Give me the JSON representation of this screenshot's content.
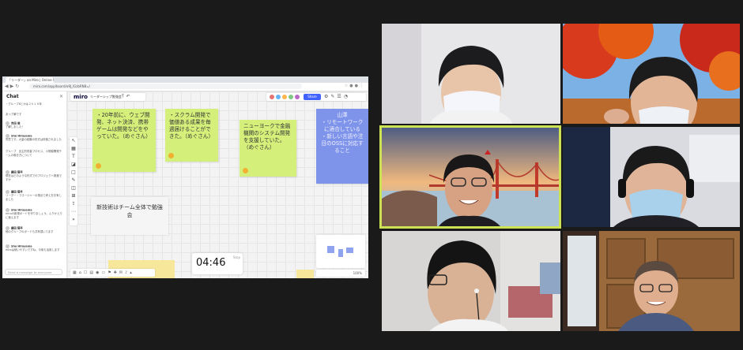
{
  "browser": {
    "tab_title": "「リーダー」on Miro | Online Whiteboard",
    "url": "miro.com/app/board/o9J_lGzbRN8=/"
  },
  "chat": {
    "title": "Chat",
    "close_icon": "close-icon",
    "messages": [
      {
        "name": "",
        "text": "・グループ6とかは２０１９年"
      },
      {
        "name": "",
        "text": "あっ了解です"
      },
      {
        "name": "吉田 雅",
        "text": "了解しました！"
      },
      {
        "name": "Sho Hirayama",
        "text": "同意です。大量の経験の形式は評価されました"
      },
      {
        "name": "",
        "text": "グループ　自主的改善プロセス、小規模開発チームの働き方について"
      },
      {
        "name": "藤田 陽平",
        "text": "現在はどのような形式でのプロジェクト推進ですか"
      },
      {
        "name": "藤田 陽平",
        "text": "リーダー・マネージャーの視点で考えを共有しました"
      },
      {
        "name": "Sho Hirayama",
        "text": "miroの新規ボードを作りましょう。ふりかえりに使えます"
      },
      {
        "name": "藤田 陽平",
        "text": "他のグループのボードも共有頂いてます"
      },
      {
        "name": "Sho Hirayama",
        "text": "miroは使いやすいですね。今後も活用します"
      }
    ],
    "input_placeholder": "Send a message to everyone"
  },
  "miro": {
    "logo": "miro",
    "board_name": "リーダーシップ勉強会",
    "share_label": "Share",
    "stickies": [
      {
        "text": "・20年前に、ウェブ開発、ネット決済、携帯ゲームは開発などをやっていた。（めぐさん）",
        "color": "#d4f07b"
      },
      {
        "text": "・スクラム開発で価値ある成果を毎週届けることができた。（めぐさん）",
        "color": "#d4f07b"
      },
      {
        "text": "ニューヨークで金融機関のシステム開発を支援していた。（めぐさん）",
        "color": "#d4f07b"
      },
      {
        "text": "山澤\n・リモートワークに適合している\n・新しい言語や注目のOSSに対応すること",
        "color": "#7e93ea"
      }
    ],
    "card_text": "新技術はチーム全体で勉強会",
    "timer": "04:46",
    "timer_label": "Stop",
    "zoom": "100%"
  },
  "participants": [
    {
      "tile": "top-left",
      "active_speaker": false
    },
    {
      "tile": "top-right",
      "active_speaker": false
    },
    {
      "tile": "middle-left",
      "active_speaker": true,
      "highlight_color": "#cde154"
    },
    {
      "tile": "middle-right",
      "active_speaker": false
    },
    {
      "tile": "bottom-left",
      "active_speaker": false
    },
    {
      "tile": "bottom-right",
      "active_speaker": false
    }
  ]
}
